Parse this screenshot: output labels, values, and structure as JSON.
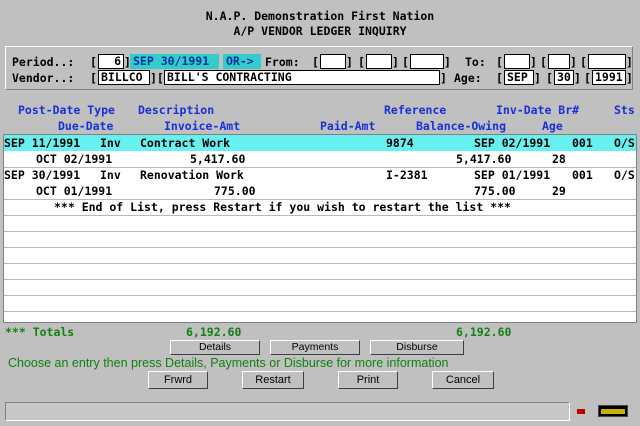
{
  "header": {
    "title": "N.A.P. Demonstration First Nation",
    "subtitle": "A/P VENDOR LEDGER INQUIRY"
  },
  "form": {
    "period_label": "Period..:",
    "period_value": "6",
    "period_date": "SEP 30/1991",
    "or_label": "OR->",
    "from_label": "From:",
    "to_label": "To:",
    "vendor_label": "Vendor..:",
    "vendor_code": "BILLCO",
    "vendor_name": "BILL'S CONTRACTING",
    "age_label": "Age:",
    "age_month": "SEP",
    "age_day": "30",
    "age_year": "1991"
  },
  "columns": {
    "row1": {
      "post_date_type": "Post-Date Type",
      "description": "Description",
      "reference": "Reference",
      "inv_date_br": "Inv-Date Br#",
      "sts": "Sts"
    },
    "row2": {
      "due_date": "Due-Date",
      "invoice_amt": "Invoice-Amt",
      "paid_amt": "Paid-Amt",
      "balance_owing": "Balance-Owing",
      "age": "Age"
    }
  },
  "entries": [
    {
      "post_date": "SEP 11/1991",
      "type": "Inv",
      "description": "Contract Work",
      "reference": "9874",
      "inv_date": "SEP 02/1991",
      "branch": "001",
      "status": "O/S",
      "due_date": "OCT 02/1991",
      "invoice_amt": "5,417.60",
      "paid_amt": "",
      "balance_owing": "5,417.60",
      "age": "28"
    },
    {
      "post_date": "SEP 30/1991",
      "type": "Inv",
      "description": "Renovation Work",
      "reference": "I-2381",
      "inv_date": "SEP 01/1991",
      "branch": "001",
      "status": "O/S",
      "due_date": "OCT 01/1991",
      "invoice_amt": "775.00",
      "paid_amt": "",
      "balance_owing": "775.00",
      "age": "29"
    }
  ],
  "end_message": "*** End of List, press Restart if you wish to restart the list ***",
  "totals": {
    "label": "*** Totals",
    "invoice_total": "6,192.60",
    "balance_total": "6,192.60"
  },
  "buttons": {
    "details": "Details",
    "payments": "Payments",
    "disburse": "Disburse",
    "frwrd": "Frwrd",
    "restart": "Restart",
    "print": "Print",
    "cancel": "Cancel"
  },
  "instruction": "Choose an entry then press Details, Payments or Disburse for more information",
  "colors": {
    "background": "#c0c0c0",
    "header_blue": "#1a2fd6",
    "totals_green": "#108010",
    "selected_row": "#66f0f0",
    "highlight_field": "#33cccc"
  }
}
